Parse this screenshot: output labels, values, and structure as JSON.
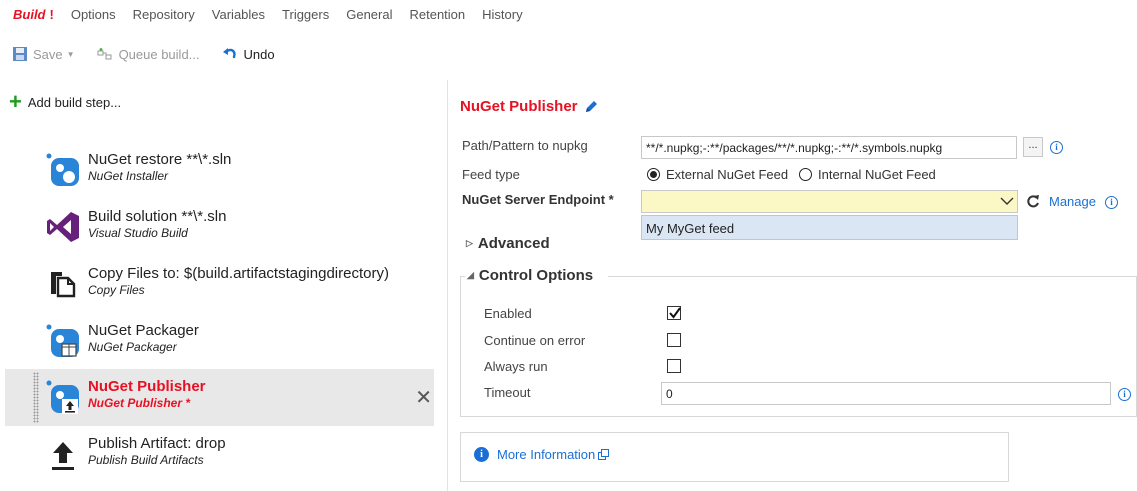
{
  "tabs": [
    {
      "label": "Build",
      "active": true,
      "error_mark": "!"
    },
    {
      "label": "Options"
    },
    {
      "label": "Repository"
    },
    {
      "label": "Variables"
    },
    {
      "label": "Triggers"
    },
    {
      "label": "General"
    },
    {
      "label": "Retention"
    },
    {
      "label": "History"
    }
  ],
  "toolbar": {
    "save_label": "Save",
    "queue_label": "Queue build...",
    "undo_label": "Undo"
  },
  "left": {
    "add_step_label": "Add build step...",
    "steps": [
      {
        "title": "NuGet restore **\\*.sln",
        "subtitle": "NuGet Installer",
        "icon": "nuget-icon"
      },
      {
        "title": "Build solution **\\*.sln",
        "subtitle": "Visual Studio Build",
        "icon": "visual-studio-icon"
      },
      {
        "title": "Copy Files to: $(build.artifactstagingdirectory)",
        "subtitle": "Copy Files",
        "icon": "copy-files-icon"
      },
      {
        "title": "NuGet Packager",
        "subtitle": "NuGet Packager",
        "icon": "nuget-packager-icon"
      },
      {
        "title": "NuGet Publisher",
        "subtitle": "NuGet Publisher *",
        "icon": "nuget-publisher-icon",
        "selected": true
      },
      {
        "title": "Publish Artifact: drop",
        "subtitle": "Publish Build Artifacts",
        "icon": "upload-icon"
      }
    ]
  },
  "task": {
    "title": "NuGet Publisher",
    "path_label": "Path/Pattern to nupkg",
    "path_value": "**/*.nupkg;-:**/packages/**/*.nupkg;-:**/*.symbols.nupkg",
    "browse_label": "...",
    "feed_type_label": "Feed type",
    "feed_options": [
      "External NuGet Feed",
      "Internal NuGet Feed"
    ],
    "feed_selected": "External NuGet Feed",
    "endpoint_label": "NuGet Server Endpoint *",
    "endpoint_value": "",
    "endpoint_option": "My MyGet feed",
    "manage_label": "Manage",
    "advanced_label": "Advanced",
    "control_label": "Control Options",
    "enabled_label": "Enabled",
    "enabled": true,
    "continue_label": "Continue on error",
    "continue_on_error": false,
    "always_label": "Always run",
    "always_run": false,
    "timeout_label": "Timeout",
    "timeout_value": "0",
    "more_info_label": "More Information"
  },
  "colors": {
    "accent_red": "#e81123",
    "link_blue": "#1a6fd6",
    "endpoint_bg": "#fcf8c6",
    "dropdown_bg": "#dbe6f4",
    "selected_row_bg": "#e8e8e8"
  }
}
